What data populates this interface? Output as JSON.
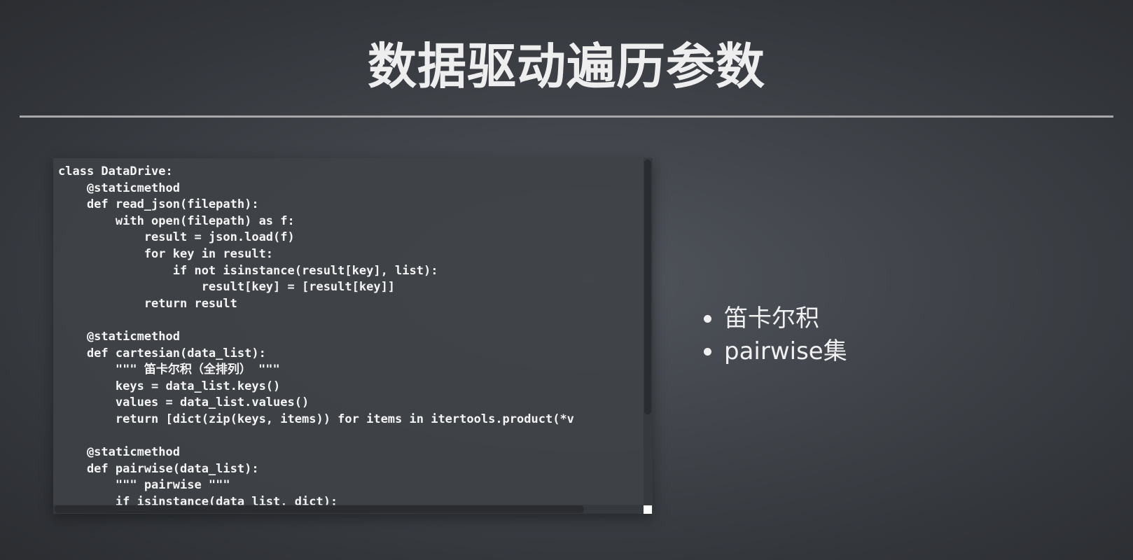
{
  "slide": {
    "title": "数据驱动遍历参数"
  },
  "code": {
    "lines": [
      "class DataDrive:",
      "    @staticmethod",
      "    def read_json(filepath):",
      "        with open(filepath) as f:",
      "            result = json.load(f)",
      "            for key in result:",
      "                if not isinstance(result[key], list):",
      "                    result[key] = [result[key]]",
      "            return result",
      "",
      "    @staticmethod",
      "    def cartesian(data_list):",
      "        \"\"\" 笛卡尔积（全排列） \"\"\"",
      "        keys = data_list.keys()",
      "        values = data_list.values()",
      "        return [dict(zip(keys, items)) for items in itertools.product(*v",
      "",
      "    @staticmethod",
      "    def pairwise(data_list):",
      "        \"\"\" pairwise \"\"\"",
      "        if isinstance(data_list, dict):"
    ]
  },
  "bullets": {
    "items": [
      {
        "label": "笛卡尔积"
      },
      {
        "label": "pairwise集"
      }
    ]
  }
}
